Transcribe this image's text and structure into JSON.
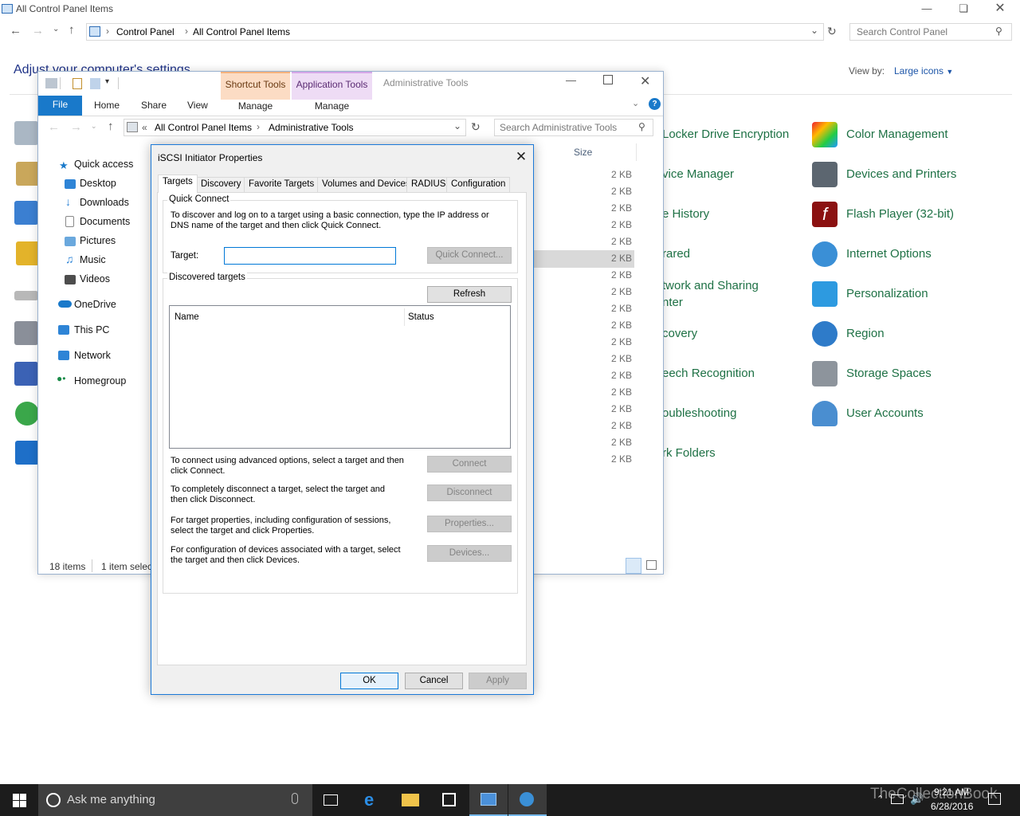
{
  "control_panel": {
    "title": "All Control Panel Items",
    "breadcrumb": [
      "Control Panel",
      "All Control Panel Items"
    ],
    "search_placeholder": "Search Control Panel",
    "heading": "Adjust your computer's settings",
    "view_by_label": "View by:",
    "view_by_value": "Large icons",
    "middle_items": [
      "Locker Drive Encryption",
      "vice Manager",
      "e History",
      "rared",
      "twork and Sharing",
      "nter",
      "covery",
      "eech Recognition",
      "oubleshooting",
      "rk Folders"
    ],
    "right_items": [
      "Color Management",
      "Devices and Printers",
      "Flash Player (32-bit)",
      "Internet Options",
      "Personalization",
      "Region",
      "Storage Spaces",
      "User Accounts"
    ]
  },
  "explorer": {
    "title": "Administrative Tools",
    "ribbon_tabs": {
      "file": "File",
      "home": "Home",
      "share": "Share",
      "view": "View"
    },
    "context_tabs": {
      "shortcut_title": "Shortcut Tools",
      "shortcut_manage": "Manage",
      "app_title": "Application Tools",
      "app_manage": "Manage"
    },
    "breadcrumb": {
      "prefix": "«",
      "parent": "All Control Panel Items",
      "current": "Administrative Tools"
    },
    "search_placeholder": "Search Administrative Tools",
    "column_size": "Size",
    "nav": {
      "quick_access": "Quick access",
      "desktop": "Desktop",
      "downloads": "Downloads",
      "documents": "Documents",
      "pictures": "Pictures",
      "music": "Music",
      "videos": "Videos",
      "onedrive": "OneDrive",
      "this_pc": "This PC",
      "network": "Network",
      "homegroup": "Homegroup"
    },
    "sizes": [
      "2 KB",
      "2 KB",
      "2 KB",
      "2 KB",
      "2 KB",
      "2 KB",
      "2 KB",
      "2 KB",
      "2 KB",
      "2 KB",
      "2 KB",
      "2 KB",
      "2 KB",
      "2 KB",
      "2 KB",
      "2 KB",
      "2 KB",
      "2 KB"
    ],
    "status_items": "18 items",
    "status_selected": "1 item selec"
  },
  "dialog": {
    "title": "iSCSI Initiator Properties",
    "tabs": [
      "Targets",
      "Discovery",
      "Favorite Targets",
      "Volumes and Devices",
      "RADIUS",
      "Configuration"
    ],
    "quick_connect": {
      "legend": "Quick Connect",
      "description": "To discover and log on to a target using a basic connection, type the IP address or DNS name of the target and then click Quick Connect.",
      "target_label": "Target:",
      "target_value": "",
      "button": "Quick Connect..."
    },
    "discovered": {
      "legend": "Discovered targets",
      "refresh": "Refresh",
      "col_name": "Name",
      "col_status": "Status"
    },
    "actions": [
      {
        "text": "To connect using advanced options, select a target and then click Connect.",
        "button": "Connect"
      },
      {
        "text": "To completely disconnect a target, select the target and then click Disconnect.",
        "button": "Disconnect"
      },
      {
        "text": "For target properties, including configuration of sessions, select the target and click Properties.",
        "button": "Properties..."
      },
      {
        "text": "For configuration of devices associated with a target, select the target and then click Devices.",
        "button": "Devices..."
      }
    ],
    "buttons": {
      "ok": "OK",
      "cancel": "Cancel",
      "apply": "Apply"
    }
  },
  "taskbar": {
    "search_placeholder": "Ask me anything",
    "time": "9:21 AM",
    "date": "6/28/2016",
    "watermark": "TheCollectionBook"
  },
  "colors": {
    "link_green": "#1e7145",
    "accent_blue": "#1979ca",
    "dialog_border": "#1b79d8",
    "taskbar": "#1c1c1c"
  }
}
